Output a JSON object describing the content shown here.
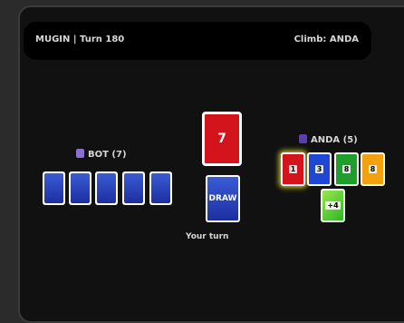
{
  "header": {
    "left": "MUGIN | Turn 180",
    "right": "Climb: ANDA"
  },
  "opponent": {
    "label": "BOT (7)",
    "avatar_color": "#8a6fd1",
    "cards": 5
  },
  "player": {
    "label": "ANDA (5)",
    "avatar_color": "#5b3fa8",
    "cards": [
      {
        "value": "1",
        "color": "#d4141c"
      },
      {
        "value": "3",
        "color": "#1f47d6"
      },
      {
        "value": "8",
        "color": "#1e9e2a"
      },
      {
        "value": "8",
        "color": "#f2a20f"
      },
      {
        "value": "+4",
        "color": "#46c92b"
      }
    ]
  },
  "discard": {
    "value": "7",
    "color": "#d4141c"
  },
  "draw_pile": {
    "label": "DRAW"
  },
  "status": "Your turn"
}
